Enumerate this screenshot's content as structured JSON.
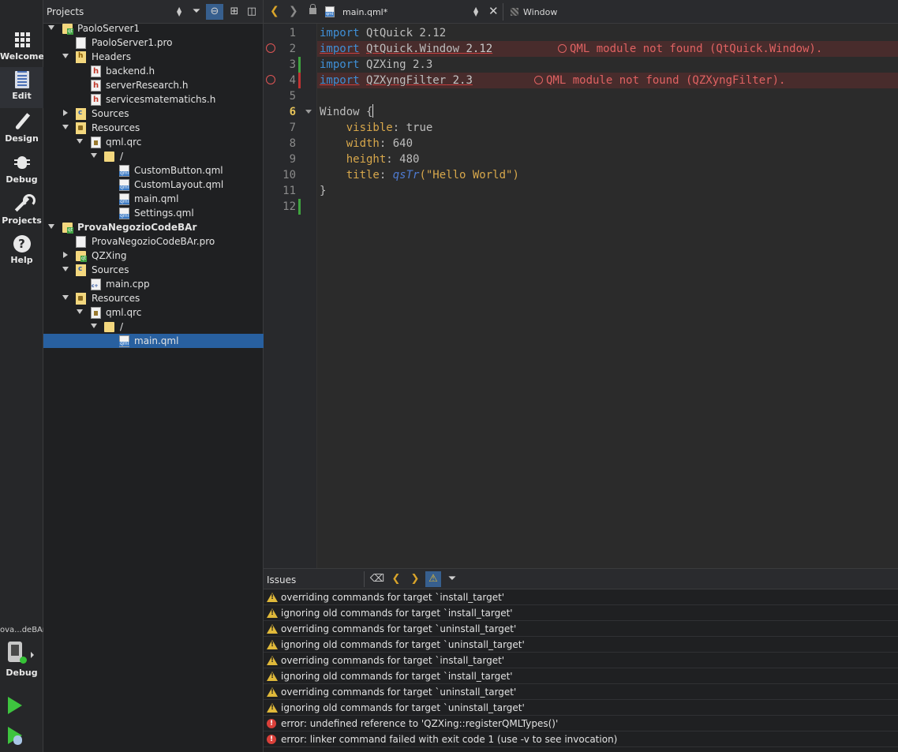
{
  "modebar": {
    "modes": [
      {
        "label": "Welcome",
        "icon": "grid-icon"
      },
      {
        "label": "Edit",
        "icon": "edit-document-icon"
      },
      {
        "label": "Design",
        "icon": "pen-icon"
      },
      {
        "label": "Debug",
        "icon": "bug-icon"
      },
      {
        "label": "Projects",
        "icon": "wrench-icon"
      },
      {
        "label": "Help",
        "icon": "help-icon"
      }
    ],
    "active_mode": "Edit",
    "target_name": "ova...deBAr",
    "target_build": "Debug"
  },
  "projects": {
    "title": "Projects",
    "tree": [
      {
        "label": "PaoloServer1",
        "type": "proj",
        "bold": false
      },
      {
        "label": "PaoloServer1.pro",
        "type": "file"
      },
      {
        "label": "Headers",
        "type": "hdr"
      },
      {
        "label": "backend.h",
        "type": "hfile"
      },
      {
        "label": "serverResearch.h",
        "type": "hfile"
      },
      {
        "label": "servicesmatematichs.h",
        "type": "hfile"
      },
      {
        "label": "Sources",
        "type": "src"
      },
      {
        "label": "Resources",
        "type": "res"
      },
      {
        "label": "qml.qrc",
        "type": "qrc"
      },
      {
        "label": "/",
        "type": "folder"
      },
      {
        "label": "CustomButton.qml",
        "type": "qml"
      },
      {
        "label": "CustomLayout.qml",
        "type": "qml"
      },
      {
        "label": "main.qml",
        "type": "qml"
      },
      {
        "label": "Settings.qml",
        "type": "qml"
      },
      {
        "label": "ProvaNegozioCodeBAr",
        "type": "proj",
        "bold": true
      },
      {
        "label": "ProvaNegozioCodeBAr.pro",
        "type": "file"
      },
      {
        "label": "QZXing",
        "type": "proj"
      },
      {
        "label": "Sources",
        "type": "src"
      },
      {
        "label": "main.cpp",
        "type": "cpp"
      },
      {
        "label": "Resources",
        "type": "res"
      },
      {
        "label": "qml.qrc",
        "type": "qrc"
      },
      {
        "label": "/",
        "type": "folder"
      },
      {
        "label": "main.qml",
        "type": "qml",
        "selected": true
      }
    ]
  },
  "editor": {
    "file_name": "main.qml*",
    "symbol": "Window",
    "line_numbers": [
      "1",
      "2",
      "3",
      "4",
      "5",
      "6",
      "7",
      "8",
      "9",
      "10",
      "11",
      "12"
    ],
    "current_line": "6",
    "code": {
      "l1_kw": "import",
      "l1_rest": " QtQuick 2.12",
      "l2_kw": "import",
      "l2_mod": "QtQuick.Window",
      "l2_ver": " 2.12",
      "l3_kw": "import",
      "l3_rest": " QZXing 2.3",
      "l4_kw": "import",
      "l4_mod": "QZXyngFilter",
      "l4_ver": " 2.3",
      "l6": "Window {",
      "l7_prop": "visible",
      "l7_val": ": true",
      "l8_prop": "width",
      "l8_val": ": 640",
      "l9_prop": "height",
      "l9_val": ": 480",
      "l10_prop": "title",
      "l10_fn": "qsTr",
      "l10_val": "(\"Hello World\")",
      "l11": "}"
    },
    "diagnostics": {
      "l2": "QML module not found (QtQuick.Window).",
      "l4": "QML module not found (QZXyngFilter)."
    }
  },
  "issues": {
    "title": "Issues",
    "items": [
      {
        "kind": "warning",
        "text": "overriding commands for target `install_target'"
      },
      {
        "kind": "warning",
        "text": "ignoring old commands for target `install_target'"
      },
      {
        "kind": "warning",
        "text": "overriding commands for target `uninstall_target'"
      },
      {
        "kind": "warning",
        "text": "ignoring old commands for target `uninstall_target'"
      },
      {
        "kind": "warning",
        "text": "overriding commands for target `install_target'"
      },
      {
        "kind": "warning",
        "text": "ignoring old commands for target `install_target'"
      },
      {
        "kind": "warning",
        "text": "overriding commands for target `uninstall_target'"
      },
      {
        "kind": "warning",
        "text": "ignoring old commands for target `uninstall_target'"
      },
      {
        "kind": "error",
        "text": "error: undefined reference to 'QZXing::registerQMLTypes()'"
      },
      {
        "kind": "error",
        "text": "error: linker command failed with exit code 1 (use -v to see invocation)"
      }
    ]
  },
  "colors": {
    "accent": "#2860a0",
    "error": "#e06262",
    "warning": "#e0b93a",
    "run": "#3ec43f"
  }
}
